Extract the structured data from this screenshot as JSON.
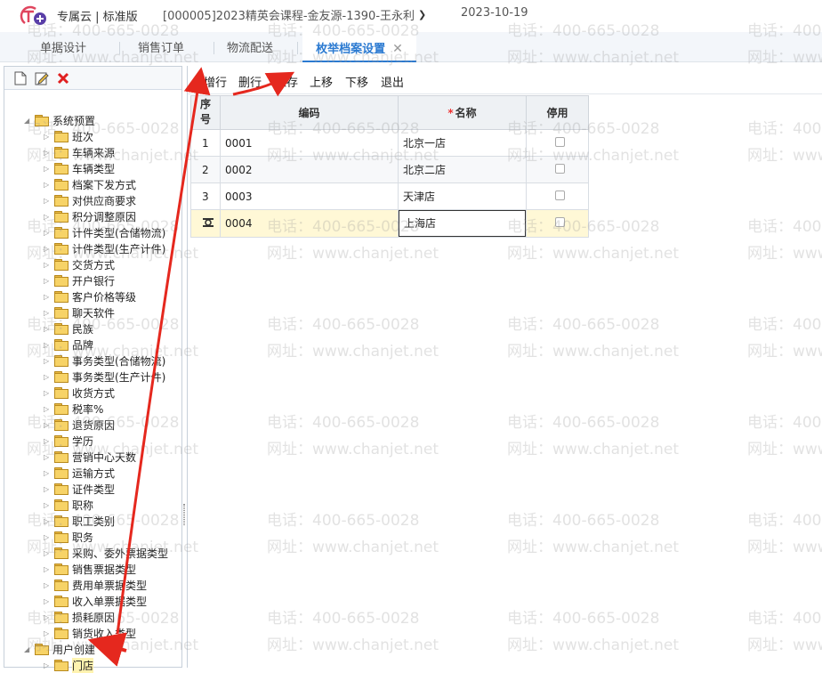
{
  "header": {
    "brand": "专属云 | 标准版",
    "company": "[000005]2023精英会课程-金友源-1390-王永利",
    "date": "2023-10-19"
  },
  "tabs": [
    {
      "label": "单据设计"
    },
    {
      "label": "销售订单"
    },
    {
      "label": "物流配送"
    },
    {
      "label": "枚举档案设置",
      "active": true
    }
  ],
  "tree": {
    "root1": "系统预置",
    "items": [
      "班次",
      "车辆来源",
      "车辆类型",
      "档案下发方式",
      "对供应商要求",
      "积分调整原因",
      "计件类型(合储物流)",
      "计件类型(生产计件)",
      "交货方式",
      "开户银行",
      "客户价格等级",
      "聊天软件",
      "民族",
      "品牌",
      "事务类型(合储物流)",
      "事务类型(生产计件)",
      "收货方式",
      "税率%",
      "退货原因",
      "学历",
      "营销中心天数",
      "运输方式",
      "证件类型",
      "职称",
      "职工类别",
      "职务",
      "采购、委外票据类型",
      "销售票据类型",
      "费用单票据类型",
      "收入单票据类型",
      "损耗原因",
      "销货收入类型"
    ],
    "root2": "用户创建",
    "user_items": [
      "门店"
    ]
  },
  "toolbar": {
    "add_row": "增行",
    "delete_row": "删行",
    "save": "保存",
    "move_up": "上移",
    "move_down": "下移",
    "exit": "退出"
  },
  "grid": {
    "headers": {
      "seq": "序号",
      "code": "编码",
      "name": "名称",
      "disabled": "停用"
    },
    "rows": [
      {
        "seq": "1",
        "code": "0001",
        "name": "北京一店"
      },
      {
        "seq": "2",
        "code": "0002",
        "name": "北京二店"
      },
      {
        "seq": "3",
        "code": "0003",
        "name": "天津店"
      },
      {
        "seq": "",
        "code": "0004",
        "name": "上海店"
      }
    ]
  },
  "watermark": {
    "phone": "电话：400-665-0028",
    "site": "网址：www.chanjet.net"
  },
  "colors": {
    "accent": "#2b7ad1",
    "arrow": "#e5281e"
  }
}
